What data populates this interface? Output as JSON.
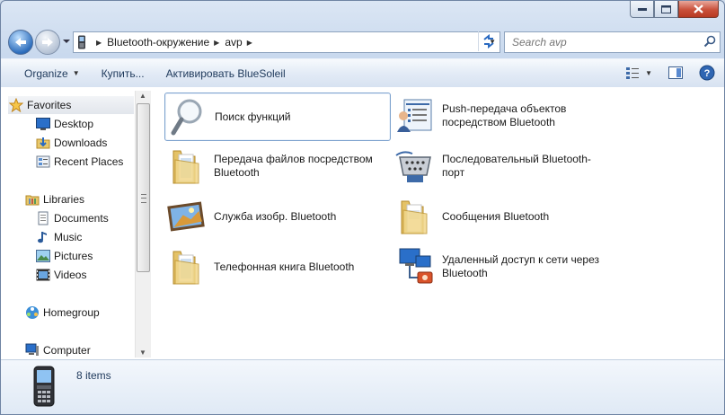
{
  "window": {
    "caption_buttons": [
      "minimize-icon",
      "maximize-icon",
      "close-icon"
    ]
  },
  "address_bar": {
    "breadcrumbs": [
      "Bluetooth-окружение",
      "avp"
    ]
  },
  "search": {
    "placeholder": "Search avp"
  },
  "toolbar": {
    "organize_label": "Organize",
    "buy_label": "Купить...",
    "activate_label": "Активировать BlueSoleil"
  },
  "nav_pane": {
    "favorites": {
      "label": "Favorites",
      "items": [
        "Desktop",
        "Downloads",
        "Recent Places"
      ]
    },
    "libraries": {
      "label": "Libraries",
      "items": [
        "Documents",
        "Music",
        "Pictures",
        "Videos"
      ]
    },
    "homegroup": "Homegroup",
    "computer": "Computer"
  },
  "content": {
    "items": [
      {
        "label": "Поиск функций",
        "icon": "magnifier-icon"
      },
      {
        "label": "Push-передача объектов посредством Bluetooth",
        "icon": "push-object-icon"
      },
      {
        "label": "Передача файлов посредством Bluetooth",
        "icon": "folder-icon"
      },
      {
        "label": "Последовательный Bluetooth-порт",
        "icon": "serial-port-icon"
      },
      {
        "label": "Служба изобр. Bluetooth",
        "icon": "image-service-icon"
      },
      {
        "label": "Сообщения Bluetooth",
        "icon": "folder-icon"
      },
      {
        "label": "Телефонная книга Bluetooth",
        "icon": "folder-icon"
      },
      {
        "label": "Удаленный доступ к сети через Bluetooth",
        "icon": "dialup-network-icon"
      }
    ]
  },
  "status_bar": {
    "count": "8 items"
  },
  "colors": {
    "accent": "#1e395b",
    "selection_border": "#7da2ce"
  }
}
